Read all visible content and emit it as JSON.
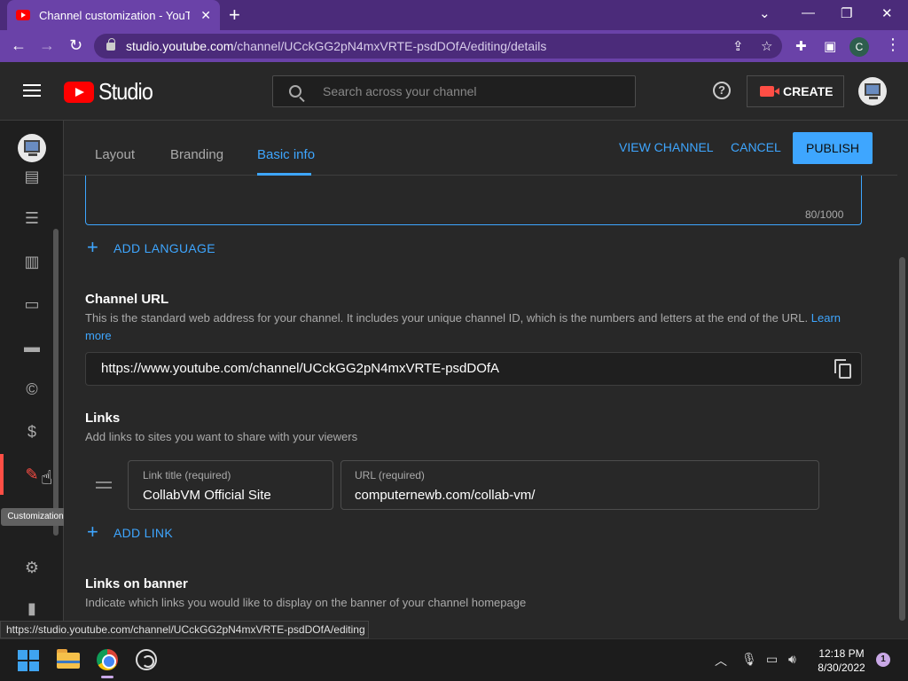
{
  "browser": {
    "tab_title": "Channel customization - YouTube Studio",
    "tab_close": "✕",
    "new_tab": "+",
    "url_host": "studio.youtube.com",
    "url_path": "/channel/UCckGG2pN4mxVRTE-psdDOfA/editing/details",
    "profile_initial": "C",
    "status_url": "https://studio.youtube.com/channel/UCckGG2pN4mxVRTE-psdDOfA/editing"
  },
  "header": {
    "app_name": "Studio",
    "search_placeholder": "Search across your channel",
    "help": "?",
    "create_label": "CREATE"
  },
  "sidebar": {
    "tooltip": "Customization"
  },
  "tabs": {
    "layout": "Layout",
    "branding": "Branding",
    "basic_info": "Basic info",
    "view_channel": "VIEW CHANNEL",
    "cancel": "CANCEL",
    "publish": "PUBLISH"
  },
  "description": {
    "char_count": "80/1000"
  },
  "add_language": "ADD LANGUAGE",
  "channel_url": {
    "title": "Channel URL",
    "desc": "This is the standard web address for your channel. It includes your unique channel ID, which is the numbers and letters at the end of the URL.",
    "learn": "Learn",
    "more": "more",
    "value": "https://www.youtube.com/channel/UCckGG2pN4mxVRTE-psdDOfA"
  },
  "links": {
    "title": "Links",
    "desc": "Add links to sites you want to share with your viewers",
    "link_title_label": "Link title (required)",
    "link_title_value": "CollabVM Official Site",
    "url_label": "URL (required)",
    "url_value": "computernewb.com/collab-vm/",
    "add_link": "ADD LINK"
  },
  "links_on_banner": {
    "title": "Links on banner",
    "desc": "Indicate which links you would like to display on the banner of your channel homepage"
  },
  "taskbar": {
    "time": "12:18 PM",
    "date": "8/30/2022",
    "notifications": "1"
  }
}
